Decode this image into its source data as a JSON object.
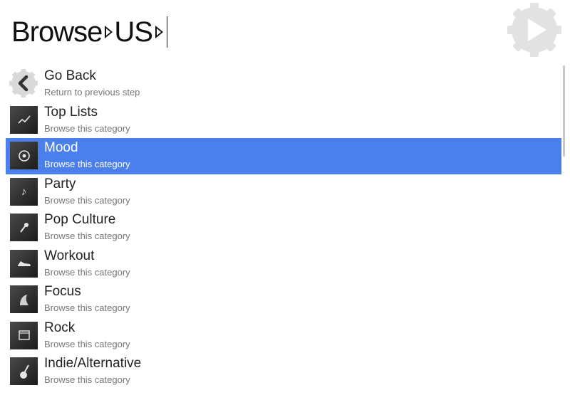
{
  "search": {
    "segments": [
      "Browse",
      "US"
    ]
  },
  "icons": {
    "run": "play-icon",
    "back": "chevron-left-icon",
    "accent": "#4a7fec"
  },
  "results": [
    {
      "title": "Go Back",
      "subtitle": "Return to previous step",
      "icon": "chevron-left-icon",
      "selected": false
    },
    {
      "title": "Top Lists",
      "subtitle": "Browse this category",
      "icon": "chart-icon",
      "selected": false
    },
    {
      "title": "Mood",
      "subtitle": "Browse this category",
      "icon": "mood-icon",
      "selected": true
    },
    {
      "title": "Party",
      "subtitle": "Browse this category",
      "icon": "party-icon",
      "selected": false
    },
    {
      "title": "Pop Culture",
      "subtitle": "Browse this category",
      "icon": "microphone-icon",
      "selected": false
    },
    {
      "title": "Workout",
      "subtitle": "Browse this category",
      "icon": "sneaker-icon",
      "selected": false
    },
    {
      "title": "Focus",
      "subtitle": "Browse this category",
      "icon": "focus-icon",
      "selected": false
    },
    {
      "title": "Rock",
      "subtitle": "Browse this category",
      "icon": "amplifier-icon",
      "selected": false
    },
    {
      "title": "Indie/Alternative",
      "subtitle": "Browse this category",
      "icon": "guitar-icon",
      "selected": false
    }
  ]
}
